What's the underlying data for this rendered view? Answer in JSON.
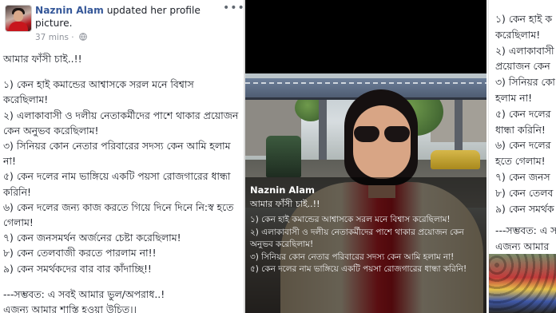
{
  "post": {
    "author": "Naznin Alam",
    "action": "updated her profile picture.",
    "time": "37 mins ·",
    "menu_icon": "more-dots-icon",
    "privacy_icon": "globe-icon",
    "lines": [
      "আমার ফাঁসী চাই..!!",
      "",
      "১) কেন হাই কমান্ডের আশ্বাসকে সরল মনে বিশ্বাস করেছিলাম!",
      "২) এলাকাবাসী ও দলীয় নেতাকর্মীদের পাশে থাকার প্রয়োজন কেন অনুভব করেছিলাম!",
      "৩) সিনিয়র কোন নেতার পরিবারের সদস্য কেন আমি হলাম না!",
      "৫) কেন দলের নাম ভাঙ্গিয়ে একটি পয়সা রোজগারের ধান্ধা করিনি!",
      "৬) কেন দলের জন্য কাজ করতে গিয়ে দিনে দিনে নি:স্ব হতে গেলাম!",
      "৭) কেন জনসমর্থন অর্জনের চেষ্টা করেছিলাম!",
      "৮) কেন তেলবাজী করতে পারলাম না!!",
      "৯) কেন সমর্থকদের বার বার কাঁদাচ্ছি!!",
      "",
      "---সম্ভবত: এ সবই আমার ভুল/অপরাধ..!",
      "এজন্য আমার শাস্তি হওয়া উচিত।।"
    ]
  },
  "photo": {
    "caption_name": "Naznin Alam",
    "caption_title": "আমার ফাঁসী চাই..!!",
    "caption_lines": [
      "১) কেন হাই কমান্ডের আশ্বাসকে সরল মনে বিশ্বাস করেছিলাম!",
      "২) এলাকাবাসী ও দলীয় নেতাকর্মীদের পাশে থাকার প্রয়োজন কেন অনুভব করেছিলাম!",
      "৩) সিনিয়র কোন নেতার পরিবারের সদস্য কেন আমি হলাম না!",
      "৫) কেন দলের নাম ভাঙ্গিয়ে একটি পয়সা রোজগারের ধান্ধা করিনি!"
    ]
  },
  "repeat": {
    "lines": [
      "১) কেন হাই ক",
      "করেছিলাম!",
      "২) এলাকাবাসী ও",
      "প্রয়োজন কেন",
      "৩) সিনিয়র কো",
      "হলাম না!",
      "৫) কেন দলের",
      "ধান্ধা করিনি!",
      "৬) কেন দলের",
      "হতে গেলাম!",
      "৭) কেন জনস",
      "৮) কেন তেলব",
      "৯) কেন সমর্থক",
      "",
      "---সম্ভবত: এ স",
      "এজন্য আমার"
    ]
  }
}
